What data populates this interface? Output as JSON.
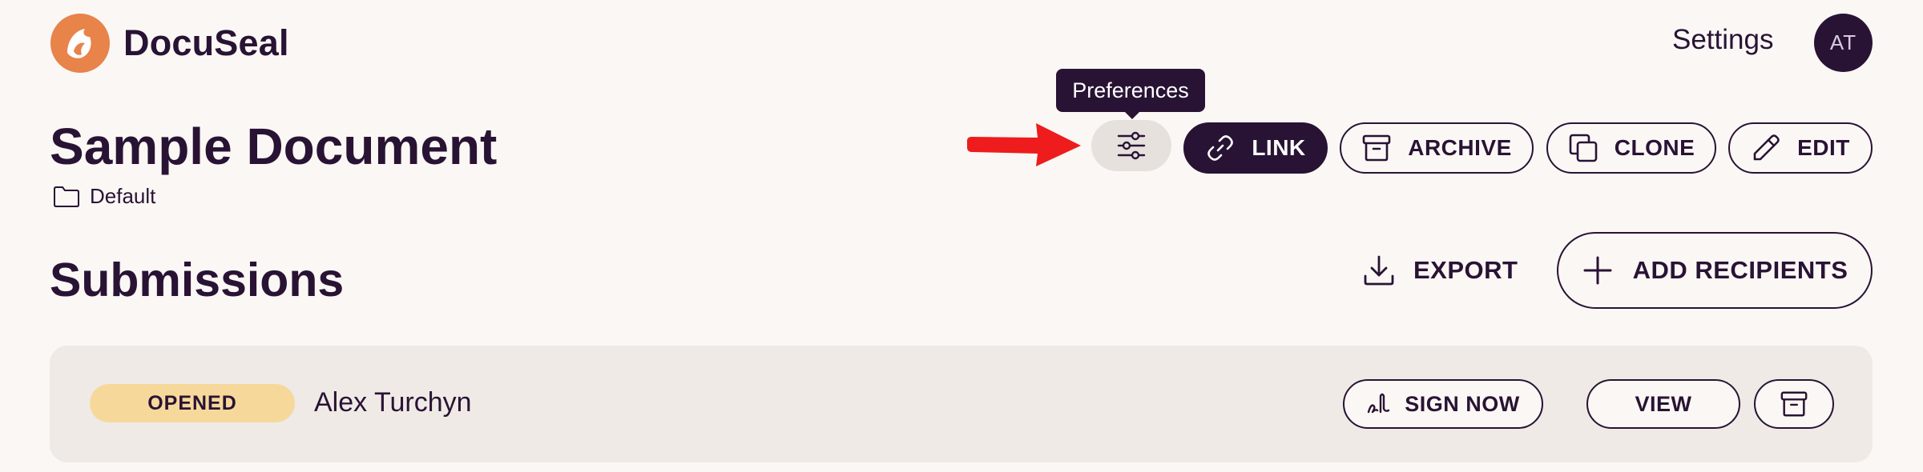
{
  "header": {
    "brand": "DocuSeal",
    "settings_label": "Settings",
    "avatar_initials": "AT"
  },
  "template": {
    "title": "Sample Document",
    "folder": "Default"
  },
  "tooltip": {
    "text": "Preferences"
  },
  "actions": {
    "link_label": "LINK",
    "archive_label": "ARCHIVE",
    "clone_label": "CLONE",
    "edit_label": "EDIT"
  },
  "submissions": {
    "title": "Submissions",
    "export_label": "EXPORT",
    "add_recipients_label": "ADD RECIPIENTS",
    "rows": [
      {
        "status": "OPENED",
        "name": "Alex Turchyn",
        "sign_now_label": "SIGN NOW",
        "view_label": "VIEW"
      }
    ]
  },
  "colors": {
    "primary": "#291334",
    "background": "#faf7f5",
    "row_background": "#efeae6",
    "status_opened": "#f6d89a",
    "logo_orange": "#e8834a",
    "annotation_red": "#ee1c1c"
  },
  "icons": {
    "logo": "docuseal-logo-icon",
    "folder": "folder-icon",
    "preferences": "sliders-icon",
    "link": "link-icon",
    "archive": "archive-icon",
    "clone": "copy-icon",
    "edit": "pencil-icon",
    "export": "download-icon",
    "add": "plus-icon",
    "sign": "signature-icon",
    "annotation": "red-arrow-icon"
  }
}
